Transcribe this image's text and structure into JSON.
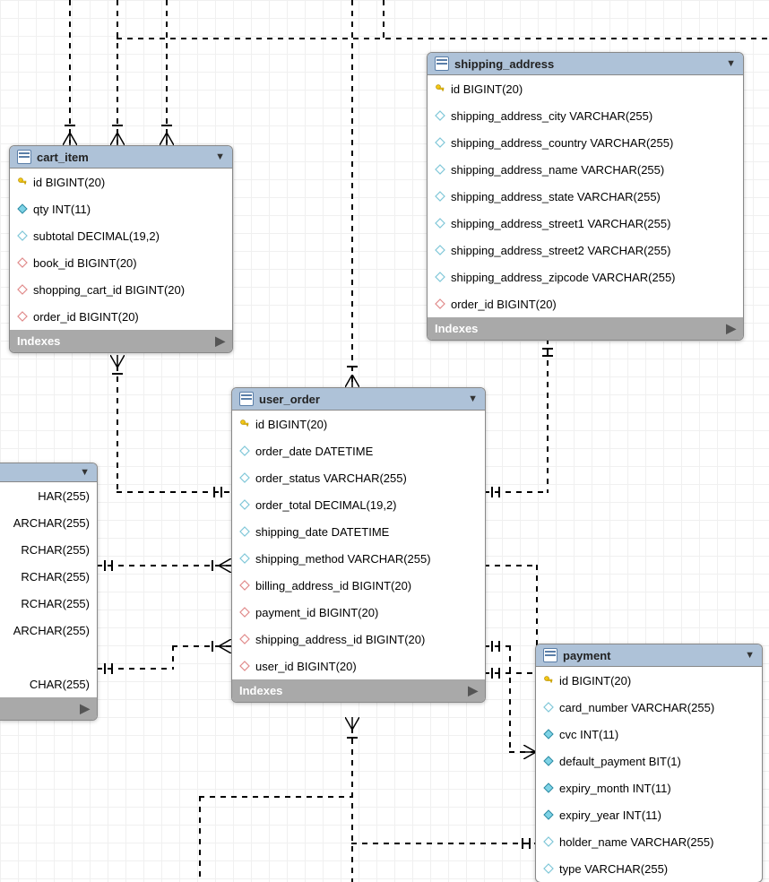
{
  "tables": {
    "shipping_address": {
      "title": "shipping_address",
      "columns": [
        {
          "icon": "key",
          "def": "id BIGINT(20)"
        },
        {
          "icon": "dia_open",
          "def": "shipping_address_city VARCHAR(255)"
        },
        {
          "icon": "dia_open",
          "def": "shipping_address_country VARCHAR(255)"
        },
        {
          "icon": "dia_open",
          "def": "shipping_address_name VARCHAR(255)"
        },
        {
          "icon": "dia_open",
          "def": "shipping_address_state VARCHAR(255)"
        },
        {
          "icon": "dia_open",
          "def": "shipping_address_street1 VARCHAR(255)"
        },
        {
          "icon": "dia_open",
          "def": "shipping_address_street2 VARCHAR(255)"
        },
        {
          "icon": "dia_open",
          "def": "shipping_address_zipcode VARCHAR(255)"
        },
        {
          "icon": "dia_red",
          "def": "order_id BIGINT(20)"
        }
      ],
      "indexes_label": "Indexes"
    },
    "cart_item": {
      "title": "cart_item",
      "columns": [
        {
          "icon": "key",
          "def": "id BIGINT(20)"
        },
        {
          "icon": "dia_fill",
          "def": "qty INT(11)"
        },
        {
          "icon": "dia_open",
          "def": "subtotal DECIMAL(19,2)"
        },
        {
          "icon": "dia_red",
          "def": "book_id BIGINT(20)"
        },
        {
          "icon": "dia_red",
          "def": "shopping_cart_id BIGINT(20)"
        },
        {
          "icon": "dia_red",
          "def": "order_id BIGINT(20)"
        }
      ],
      "indexes_label": "Indexes"
    },
    "user_order": {
      "title": "user_order",
      "columns": [
        {
          "icon": "key",
          "def": "id BIGINT(20)"
        },
        {
          "icon": "dia_open",
          "def": "order_date DATETIME"
        },
        {
          "icon": "dia_open",
          "def": "order_status VARCHAR(255)"
        },
        {
          "icon": "dia_open",
          "def": "order_total DECIMAL(19,2)"
        },
        {
          "icon": "dia_open",
          "def": "shipping_date DATETIME"
        },
        {
          "icon": "dia_open",
          "def": "shipping_method VARCHAR(255)"
        },
        {
          "icon": "dia_red",
          "def": "billing_address_id BIGINT(20)"
        },
        {
          "icon": "dia_red",
          "def": "payment_id BIGINT(20)"
        },
        {
          "icon": "dia_red",
          "def": "shipping_address_id BIGINT(20)"
        },
        {
          "icon": "dia_red",
          "def": "user_id BIGINT(20)"
        }
      ],
      "indexes_label": "Indexes"
    },
    "payment": {
      "title": "payment",
      "columns": [
        {
          "icon": "key",
          "def": "id BIGINT(20)"
        },
        {
          "icon": "dia_open",
          "def": "card_number VARCHAR(255)"
        },
        {
          "icon": "dia_fill",
          "def": "cvc INT(11)"
        },
        {
          "icon": "dia_fill",
          "def": "default_payment BIT(1)"
        },
        {
          "icon": "dia_fill",
          "def": "expiry_month INT(11)"
        },
        {
          "icon": "dia_fill",
          "def": "expiry_year INT(11)"
        },
        {
          "icon": "dia_open",
          "def": "holder_name VARCHAR(255)"
        },
        {
          "icon": "dia_open",
          "def": "type VARCHAR(255)"
        }
      ]
    },
    "left_partial": {
      "columns": [
        {
          "icon": "none",
          "def": "HAR(255)"
        },
        {
          "icon": "none",
          "def": "ARCHAR(255)"
        },
        {
          "icon": "none",
          "def": "RCHAR(255)"
        },
        {
          "icon": "none",
          "def": "RCHAR(255)"
        },
        {
          "icon": "none",
          "def": "RCHAR(255)"
        },
        {
          "icon": "none",
          "def": "ARCHAR(255)"
        },
        {
          "icon": "none",
          "def": ""
        },
        {
          "icon": "none",
          "def": "CHAR(255)"
        }
      ]
    }
  }
}
